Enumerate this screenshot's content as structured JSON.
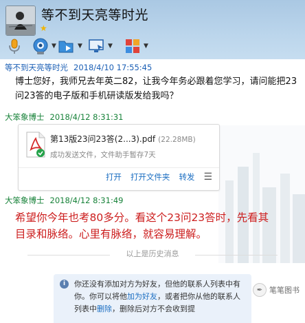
{
  "header": {
    "title": "等不到天亮等时光",
    "star": "★"
  },
  "toolbar": {
    "items": [
      {
        "icon": "microphone-icon"
      },
      {
        "icon": "webcam-icon"
      },
      {
        "icon": "send-file-icon"
      },
      {
        "icon": "remote-desktop-icon"
      },
      {
        "icon": "apps-grid-icon"
      }
    ]
  },
  "messages": [
    {
      "sender": "等不到天亮等时光",
      "time": "2018/4/10 17:55:45",
      "lines": [
        "博士您好，我师兄去年英二82，让我今年务必跟着您学习，请问能把23",
        "问23答的电子版和手机研读版发给我吗？"
      ]
    },
    {
      "sender": "大笨象博士",
      "time": "2018/4/12 8:31:31",
      "file": {
        "name": "第13版23问23答(2...3).pdf",
        "size": "(22.28MB)",
        "status": "成功发送文件，文件助手暂存7天",
        "actions": [
          "打开",
          "打开文件夹",
          "转发"
        ],
        "menu": "☰"
      }
    },
    {
      "sender": "大笨象博士",
      "time": "2018/4/12 8:31:49",
      "lines": [
        "希望你今年也考80多分。看这个23问23答时，先看其",
        "目录和脉络。心里有脉络，就容易理解。"
      ]
    }
  ],
  "history_label": "以上是历史消息",
  "notice": {
    "part1": "你还没有添加对方为好友，但他的联系人列表中有你。你可以将他",
    "link1": "加为好友",
    "part2": "，或者把你从他的联系人列表中",
    "link2": "删除",
    "part3": "，删除后对方不会收到提"
  },
  "watermark": {
    "text": "笔笔图书"
  },
  "colors": {
    "header_bg": "#bcd6ec",
    "my_name": "#1b5fb5",
    "other_name": "#178239",
    "highlight_text": "#cc1e1e",
    "link": "#1d6fc2"
  }
}
